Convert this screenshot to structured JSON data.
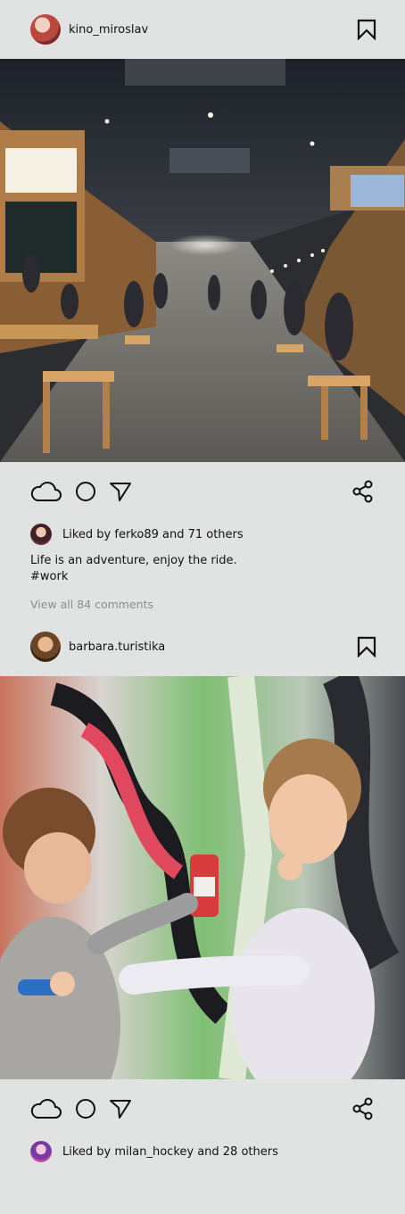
{
  "theme": {
    "background": "#e1e3e2",
    "icon_color": "#111111",
    "muted_text": "#8d8d8d"
  },
  "posts": [
    {
      "username": "kino_miroslav",
      "avatar_icon": "user-avatar",
      "image": "food-court-photo",
      "liked_by_text": "Liked by ferko89 and 71 others",
      "caption": "Life is an adventure, enjoy the ride.",
      "hashtag": "#work",
      "comments_link": "View all 84 comments"
    },
    {
      "username": "barbara.turistika",
      "avatar_icon": "user-avatar",
      "image": "children-graffiti-photo",
      "liked_by_text": "Liked by milan_hockey and 28 others"
    }
  ],
  "icons": [
    "cloud-like-icon",
    "comment-circle-icon",
    "send-arrow-icon",
    "share-icon",
    "bookmark-icon"
  ]
}
